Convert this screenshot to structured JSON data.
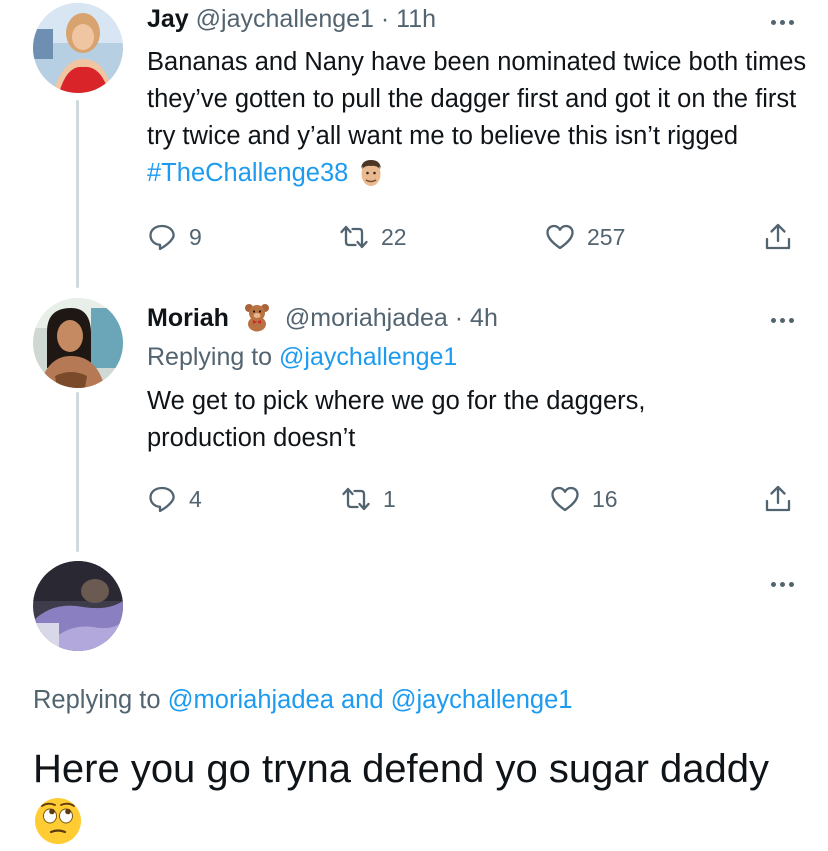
{
  "tweets": [
    {
      "name": "Jay",
      "handle": "@jaychallenge1",
      "time": "· 11h",
      "text_main": "Bananas and Nany have been nominated twice both times they’ve gotten to pull the dagger first and got it on the first try twice and y’all want me to believe this isn’t rigged ",
      "hashtag": "#TheChallenge38",
      "counts": {
        "replies": "9",
        "retweets": "22",
        "likes": "257"
      }
    },
    {
      "name": "Moriah",
      "handle": "@moriahjadea",
      "time": "· 4h",
      "replying_prefix": "Replying to ",
      "replying_handle": "@jaychallenge1",
      "text": "We get to pick where we go for the daggers, production doesn’t",
      "counts": {
        "replies": "4",
        "retweets": "1",
        "likes": "16"
      }
    }
  ],
  "focused": {
    "replying_prefix": "Replying to ",
    "replying_handle_1": "@moriahjadea",
    "replying_and": " and ",
    "replying_handle_2": "@jaychallenge1",
    "text": "Here you go tryna defend yo sugar daddy"
  },
  "colors": {
    "accent": "#1d9bf0",
    "muted": "#536471",
    "text": "#0f1419",
    "thread_line": "#cfd9de"
  },
  "icons": [
    "reply-icon",
    "retweet-icon",
    "like-icon",
    "share-icon",
    "more-icon",
    "teddy-bear-emoji",
    "man-face-emoji",
    "eye-roll-emoji"
  ]
}
